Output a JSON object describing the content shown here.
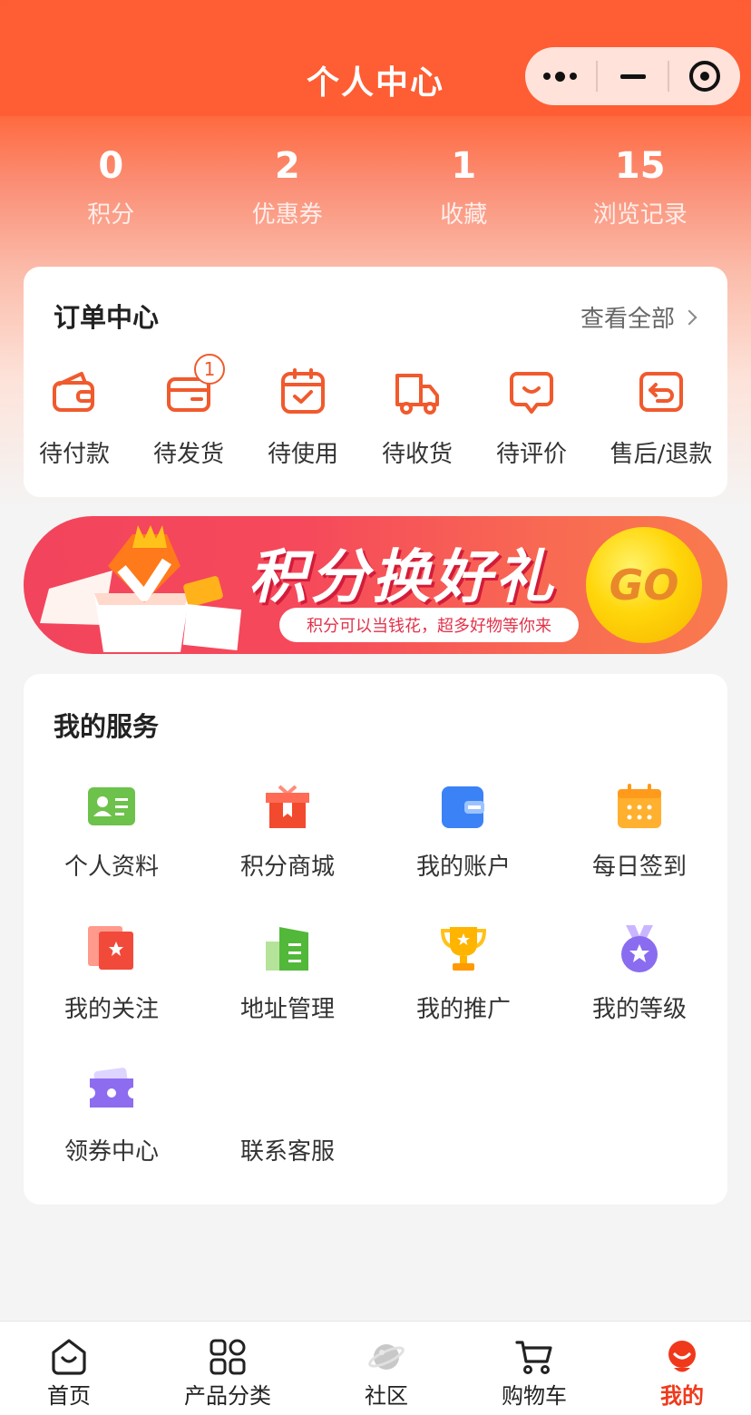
{
  "nav": {
    "title": "个人中心"
  },
  "stats": [
    {
      "value": "0",
      "label": "积分"
    },
    {
      "value": "2",
      "label": "优惠券"
    },
    {
      "value": "1",
      "label": "收藏"
    },
    {
      "value": "15",
      "label": "浏览记录"
    }
  ],
  "orders": {
    "title": "订单中心",
    "view_all": "查看全部",
    "items": [
      {
        "label": "待付款",
        "icon": "wallet-icon"
      },
      {
        "label": "待发货",
        "icon": "package-icon",
        "badge": "1"
      },
      {
        "label": "待使用",
        "icon": "calendar-check-icon"
      },
      {
        "label": "待收货",
        "icon": "truck-icon"
      },
      {
        "label": "待评价",
        "icon": "comment-icon"
      },
      {
        "label": "售后/退款",
        "icon": "return-icon"
      }
    ]
  },
  "banner": {
    "title": "积分换好礼",
    "subtitle": "积分可以当钱花，超多好物等你来",
    "go": "GO"
  },
  "services": {
    "title": "我的服务",
    "items": [
      {
        "label": "个人资料",
        "icon": "profile-card-icon"
      },
      {
        "label": "积分商城",
        "icon": "gift-box-icon"
      },
      {
        "label": "我的账户",
        "icon": "wallet-card-icon"
      },
      {
        "label": "每日签到",
        "icon": "calendar-icon"
      },
      {
        "label": "我的关注",
        "icon": "star-card-icon"
      },
      {
        "label": "地址管理",
        "icon": "building-icon"
      },
      {
        "label": "我的推广",
        "icon": "trophy-icon"
      },
      {
        "label": "我的等级",
        "icon": "medal-icon"
      },
      {
        "label": "领券中心",
        "icon": "coupon-icon"
      },
      {
        "label": "联系客服",
        "icon": ""
      }
    ]
  },
  "tabs": [
    {
      "label": "首页",
      "icon": "home-icon"
    },
    {
      "label": "产品分类",
      "icon": "grid-icon"
    },
    {
      "label": "社区",
      "icon": "planet-icon"
    },
    {
      "label": "购物车",
      "icon": "cart-icon"
    },
    {
      "label": "我的",
      "icon": "user-icon",
      "active": true
    }
  ],
  "colors": {
    "accent": "#ff5d33",
    "tab_active": "#f0391b"
  }
}
